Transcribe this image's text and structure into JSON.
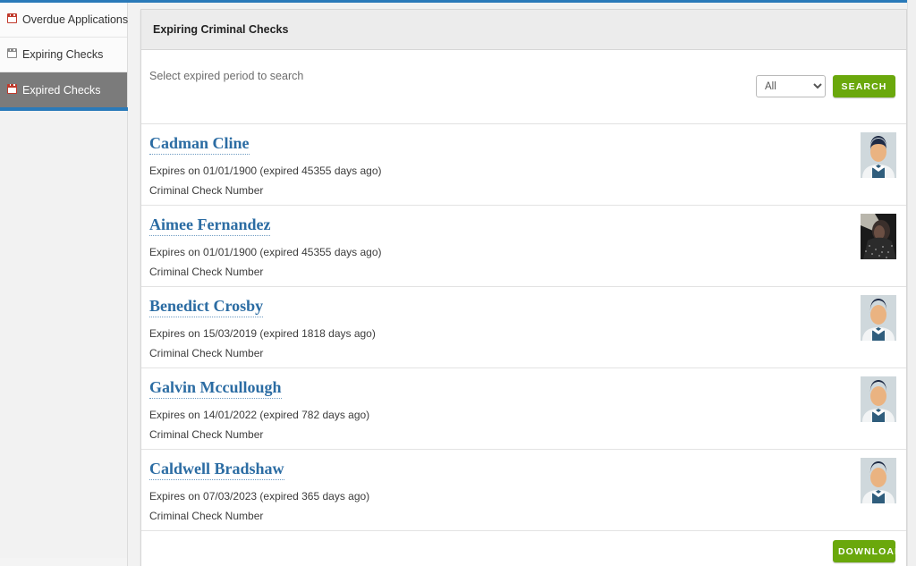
{
  "theme": {
    "accent_blue": "#2a7ab9",
    "green_button": "#6aa80c",
    "link_blue": "#2b6ca3",
    "active_sidebar_bg": "#7b7b7b",
    "icon_red": "#c0392b"
  },
  "sidebar": {
    "items": [
      {
        "label": "Overdue Applications",
        "icon": "calendar-icon",
        "icon_color": "#c0392b",
        "active": false
      },
      {
        "label": "Expiring Checks",
        "icon": "calendar-icon",
        "icon_color": "#8a8a8a",
        "active": false
      },
      {
        "label": "Expired Checks",
        "icon": "calendar-icon",
        "icon_color": "#c0392b",
        "active": true
      }
    ]
  },
  "panel": {
    "title": "Expiring Criminal Checks",
    "search": {
      "label": "Select expired period to search",
      "selected_option": "All",
      "options": [
        "All"
      ],
      "button_label": "SEARCH",
      "dropdown_icon": "chevron-down-icon"
    },
    "results": [
      {
        "name": "Cadman Cline",
        "expiry": "Expires on 01/01/1900 (expired 45355 days ago)",
        "check_number_label": "Criminal Check Number",
        "avatar": "male-illustration-avatar"
      },
      {
        "name": "Aimee Fernandez",
        "expiry": "Expires on 01/01/1900 (expired 45355 days ago)",
        "check_number_label": "Criminal Check Number",
        "avatar": "photo-avatar-dark"
      },
      {
        "name": "Benedict Crosby",
        "expiry": "Expires on 15/03/2019 (expired 1818 days ago)",
        "check_number_label": "Criminal Check Number",
        "avatar": "male-illustration-avatar"
      },
      {
        "name": "Galvin Mccullough",
        "expiry": "Expires on 14/01/2022 (expired 782 days ago)",
        "check_number_label": "Criminal Check Number",
        "avatar": "male-illustration-avatar"
      },
      {
        "name": "Caldwell Bradshaw",
        "expiry": "Expires on 07/03/2023 (expired 365 days ago)",
        "check_number_label": "Criminal Check Number",
        "avatar": "male-illustration-avatar"
      }
    ],
    "footer": {
      "download_label": "DOWNLOAD"
    }
  }
}
